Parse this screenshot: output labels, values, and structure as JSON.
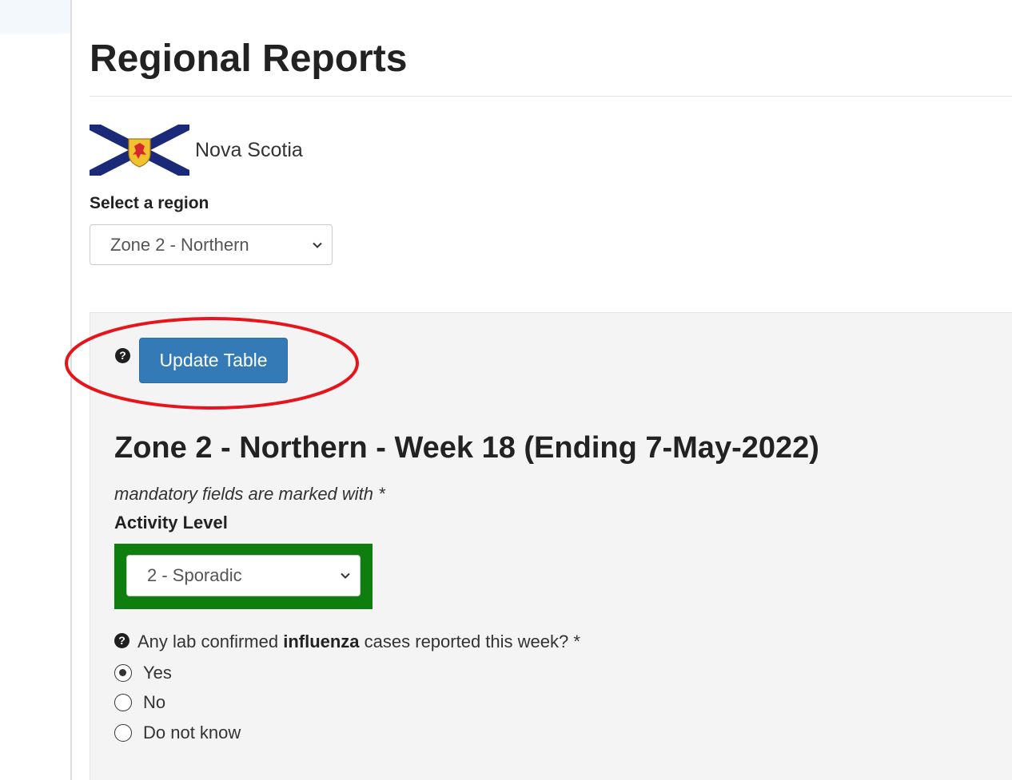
{
  "header": {
    "title": "Regional Reports"
  },
  "province": {
    "name": "Nova Scotia",
    "flag_icon": "nova-scotia-flag"
  },
  "region": {
    "label": "Select a region",
    "selected": "Zone 2 - Northern"
  },
  "toolbar": {
    "update_label": "Update Table",
    "help_icon": "question-circle-icon"
  },
  "report": {
    "heading": "Zone 2 - Northern - Week 18 (Ending 7-May-2022)",
    "mandatory_note": "mandatory fields are marked with *",
    "activity_label": "Activity Level",
    "activity_selected": "2 - Sporadic",
    "question_prefix": "Any lab confirmed ",
    "question_bold": "influenza",
    "question_suffix": " cases reported this week? *",
    "options": [
      {
        "label": "Yes",
        "checked": true
      },
      {
        "label": "No",
        "checked": false
      },
      {
        "label": "Do not know",
        "checked": false
      }
    ]
  },
  "colors": {
    "primary_button": "#337ab7",
    "highlight_ellipse": "#e8141b",
    "activity_frame": "#0e7f0e",
    "flag_blue": "#1a2a78",
    "flag_gold": "#f2c12e",
    "flag_red": "#d9262c"
  }
}
